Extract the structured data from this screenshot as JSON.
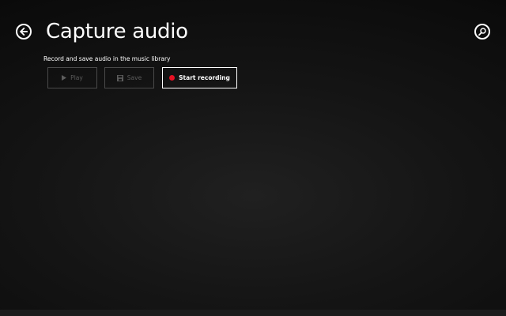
{
  "header": {
    "title": "Capture audio",
    "back_icon": "back-arrow-icon",
    "search_icon": "search-icon"
  },
  "description": "Record and save audio in the music library",
  "buttons": {
    "play": {
      "label": "Play",
      "icon": "play-icon",
      "enabled": false
    },
    "save": {
      "label": "Save",
      "icon": "floppy-disk-icon",
      "enabled": false
    },
    "record": {
      "label": "Start recording",
      "icon": "record-dot-icon",
      "enabled": true
    }
  },
  "colors": {
    "record_dot": "#e81123",
    "disabled_text": "#5c5c5c",
    "disabled_border": "#4a4a4a",
    "foreground": "#ffffff"
  }
}
